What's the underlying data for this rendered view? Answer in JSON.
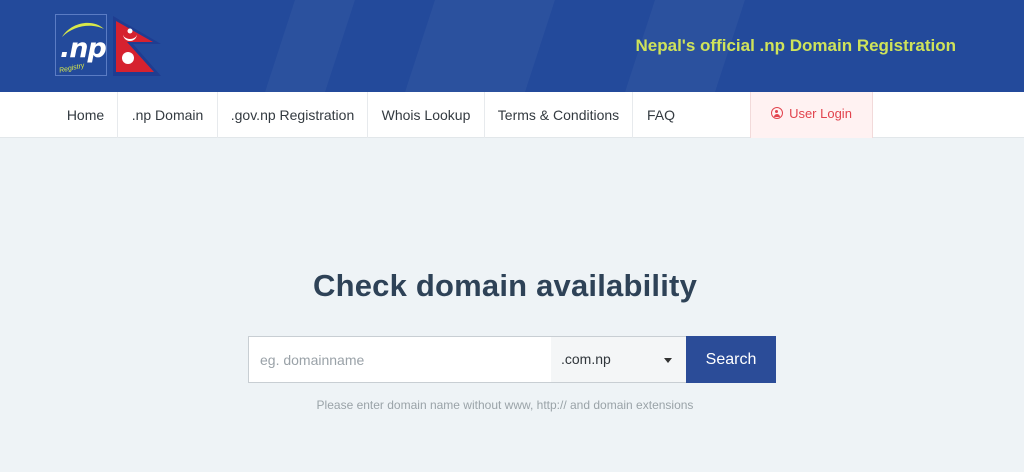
{
  "header": {
    "logo_text": ".np",
    "logo_sub": "Registry",
    "tagline": "Nepal's official .np Domain Registration"
  },
  "nav": {
    "items": [
      "Home",
      ".np Domain",
      ".gov.np Registration",
      "Whois Lookup",
      "Terms & Conditions",
      "FAQ"
    ],
    "login": "User Login"
  },
  "main": {
    "heading": "Check domain availability",
    "search": {
      "placeholder": "eg. domainname",
      "value": "",
      "extension": ".com.np",
      "button": "Search"
    },
    "hint": "Please enter domain name without www, http:// and domain extensions"
  },
  "colors": {
    "header_bg": "#234a9b",
    "tagline": "#cfe35a",
    "button_bg": "#2b4c98",
    "login_text": "#e2434d"
  }
}
